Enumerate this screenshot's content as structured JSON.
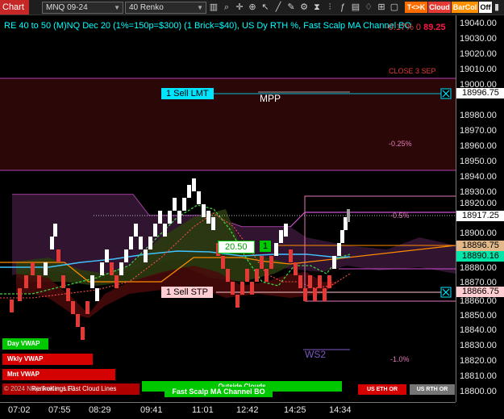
{
  "toolbar": {
    "logo": "Chart",
    "instrument": "MNQ 09-24",
    "bar_type": "40 Renko",
    "tk_button": "T<>K",
    "cloud_button": "Cloud",
    "barcol_button": "BarCol",
    "off_label": "Off",
    "colors": {
      "tk": "#ff6d00",
      "cloud": "#e53935",
      "barcol": "#ff9100"
    }
  },
  "indicator": {
    "title": "RE 40 to 50 (M)NQ Dec 20 (1%=150p=$300) (1 Brick=$40), US Dy RTH %, Fast Scalp MA Channel BO",
    "right_label": "-0.17% 0",
    "right_value": "89.25"
  },
  "labels": {
    "close_3_sep": "CLOSE 3 SEP",
    "mpp": "MPP",
    "pct_neg_025": "-0.25%",
    "pct_neg_05": "-0.5%",
    "pct_neg_1": "-1.0%",
    "ws2": "WS2"
  },
  "orders": {
    "sell_lmt": "1 Sell LMT",
    "sell_stp": "1 Sell STP",
    "position_price": "20.50",
    "position_qty": "1"
  },
  "price_axis": {
    "ticks": [
      "19040.00",
      "19030.00",
      "19020.00",
      "19010.00",
      "19000.00",
      "18990.00",
      "18980.00",
      "18970.00",
      "18960.00",
      "18950.00",
      "18940.00",
      "18930.00",
      "18920.00",
      "18910.00",
      "18900.00",
      "18890.00",
      "18880.00",
      "18870.00",
      "18860.00",
      "18850.00",
      "18840.00",
      "18830.00",
      "18820.00",
      "18810.00",
      "18800.00"
    ],
    "tags": [
      {
        "label": "18996.75",
        "bg": "#ffffff",
        "color": "#000000"
      },
      {
        "label": "18917.25",
        "bg": "#ffffff",
        "color": "#000000"
      },
      {
        "label": "18896.75",
        "bg": "#e0b88a",
        "color": "#000000"
      },
      {
        "label": "18890.16",
        "bg": "#00e5a8",
        "color": "#000000"
      },
      {
        "label": "18866.75",
        "bg": "#ffcdd2",
        "color": "#000000"
      }
    ]
  },
  "time_axis": {
    "ticks": [
      "07:02",
      "07:55",
      "08:29",
      "09:41",
      "11:01",
      "12:42",
      "14:25",
      "14:34"
    ]
  },
  "side_panel": {
    "day_vwap": "Day VWAP",
    "wkly_vwap": "Wkly VWAP",
    "mnt_vwap": "Mnt VWAP",
    "copyright": "© 2024 NinjaTrader, LLC",
    "renko_kings": "RenkoKings Fast Cloud Lines"
  },
  "bottom_panel": {
    "outside_clouds": "Outside Clouds",
    "fast_scalp": "Fast Scalp MA Channel BO",
    "us_eth_or": "US ETH OR",
    "us_rth_or": "US RTH OR"
  }
}
